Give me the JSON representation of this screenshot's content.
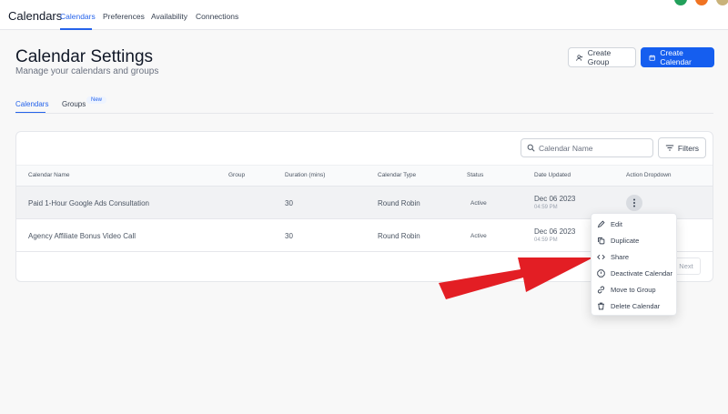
{
  "topnav": {
    "brand": "Calendars",
    "links": [
      "Calendars",
      "Preferences",
      "Availability",
      "Connections"
    ]
  },
  "header": {
    "title": "Calendar Settings",
    "subtitle": "Manage your calendars and groups",
    "create_group_label": "Create Group",
    "create_calendar_label": "Create Calendar"
  },
  "subtabs": {
    "calendars": "Calendars",
    "groups": "Groups",
    "new_badge": "New"
  },
  "search": {
    "placeholder": "Calendar Name"
  },
  "filters_label": "Filters",
  "table": {
    "columns": [
      "Calendar Name",
      "Group",
      "Duration (mins)",
      "Calendar Type",
      "Status",
      "Date Updated",
      "Action Dropdown"
    ],
    "rows": [
      {
        "name": "Paid 1-Hour Google Ads Consultation",
        "group": "",
        "duration": "30",
        "type": "Round Robin",
        "status": "Active",
        "date": "Dec 06 2023",
        "time": "04:59 PM"
      },
      {
        "name": "Agency Affiliate Bonus Video Call",
        "group": "",
        "duration": "30",
        "type": "Round Robin",
        "status": "Active",
        "date": "Dec 06 2023",
        "time": "04:59 PM"
      }
    ]
  },
  "pagination": {
    "next_label": "Next"
  },
  "menu": {
    "items": [
      {
        "label": "Edit",
        "icon": "pencil-icon"
      },
      {
        "label": "Duplicate",
        "icon": "copy-icon"
      },
      {
        "label": "Share",
        "icon": "code-icon"
      },
      {
        "label": "Deactivate Calendar",
        "icon": "alert-octagon-icon"
      },
      {
        "label": "Move to Group",
        "icon": "link-icon"
      },
      {
        "label": "Delete Calendar",
        "icon": "trash-icon"
      }
    ]
  },
  "colors": {
    "accent": "#2563eb",
    "primary_button": "#155eef",
    "arrow": "#e31e24",
    "avatar_dots": [
      "#22a05b",
      "#f07322",
      "#c9b27a"
    ]
  }
}
